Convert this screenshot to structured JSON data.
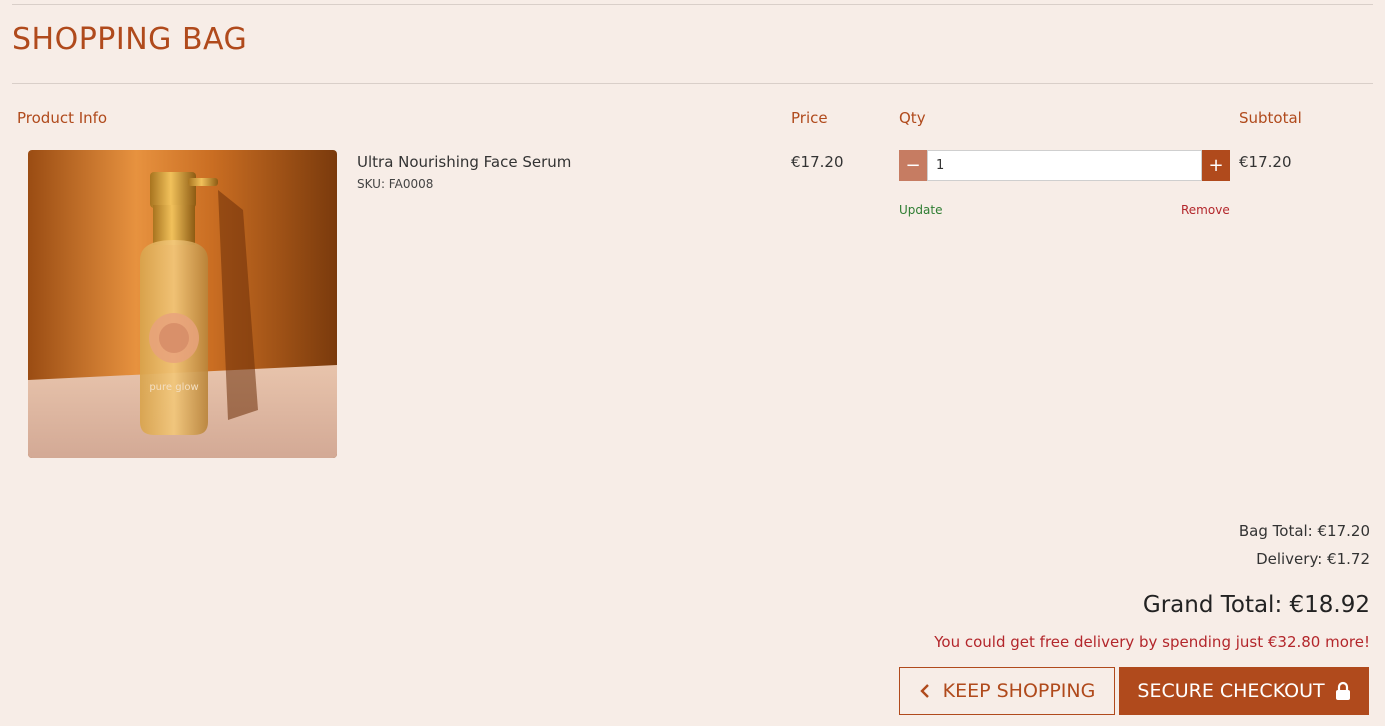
{
  "page": {
    "title": "SHOPPING BAG"
  },
  "table": {
    "headers": {
      "product_info": "Product Info",
      "price": "Price",
      "qty": "Qty",
      "subtotal": "Subtotal"
    },
    "items": [
      {
        "name": "Ultra Nourishing Face Serum",
        "sku": "SKU: FA0008",
        "price": "€17.20",
        "quantity": "1",
        "subtotal": "€17.20",
        "update_label": "Update",
        "remove_label": "Remove",
        "image_brand_text": "pure glow"
      }
    ]
  },
  "summary": {
    "bag_total": "Bag Total: €17.20",
    "delivery": "Delivery: €1.72",
    "grand_total": "Grand Total: €18.92",
    "free_delivery_msg": "You could get free delivery by spending just €32.80 more!"
  },
  "actions": {
    "keep_shopping_label": "KEEP SHOPPING",
    "keep_shopping_icon": "chevron-left-icon",
    "secure_checkout_label": "SECURE CHECKOUT",
    "secure_checkout_icon": "lock-icon"
  },
  "colors": {
    "accent": "#b04a1c",
    "background": "#f7ede7",
    "update": "#2e7d32",
    "remove": "#b3262b"
  }
}
